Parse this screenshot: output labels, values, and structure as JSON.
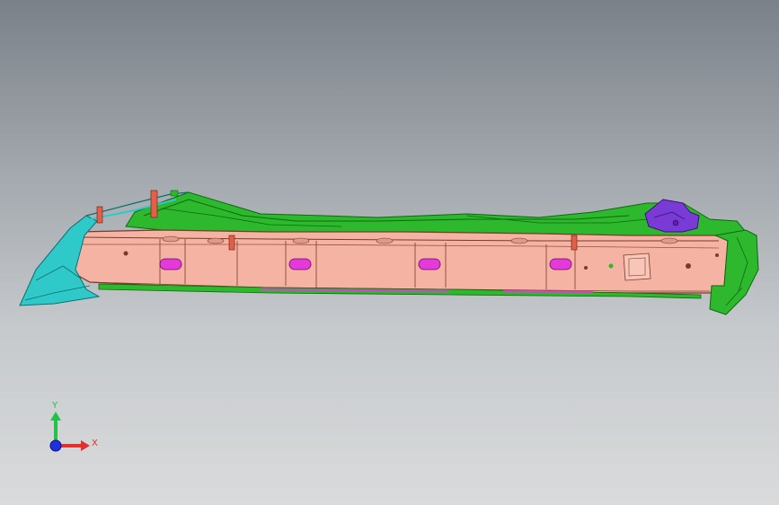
{
  "viewport": {
    "background_top": "#7a8188",
    "background_bottom": "#d9dbdc"
  },
  "model": {
    "colors": {
      "body_panel": "#f4b3a3",
      "body_edge": "#7a3a2a",
      "frame_green": "#2db82d",
      "frame_green_dark": "#0e6a0e",
      "bracket_cyan": "#30c9c9",
      "bracket_cyan_dark": "#0c6f6f",
      "bracket_purple": "#7a3ad6",
      "slot_magenta": "#e33ad9",
      "pin_red": "#e0604a"
    }
  },
  "triad": {
    "y_label": "Y",
    "x_label": "X",
    "y_color": "#22c24a",
    "x_color": "#e03030",
    "z_color": "#2030e0",
    "icon": "coordinate-triad-icon"
  }
}
